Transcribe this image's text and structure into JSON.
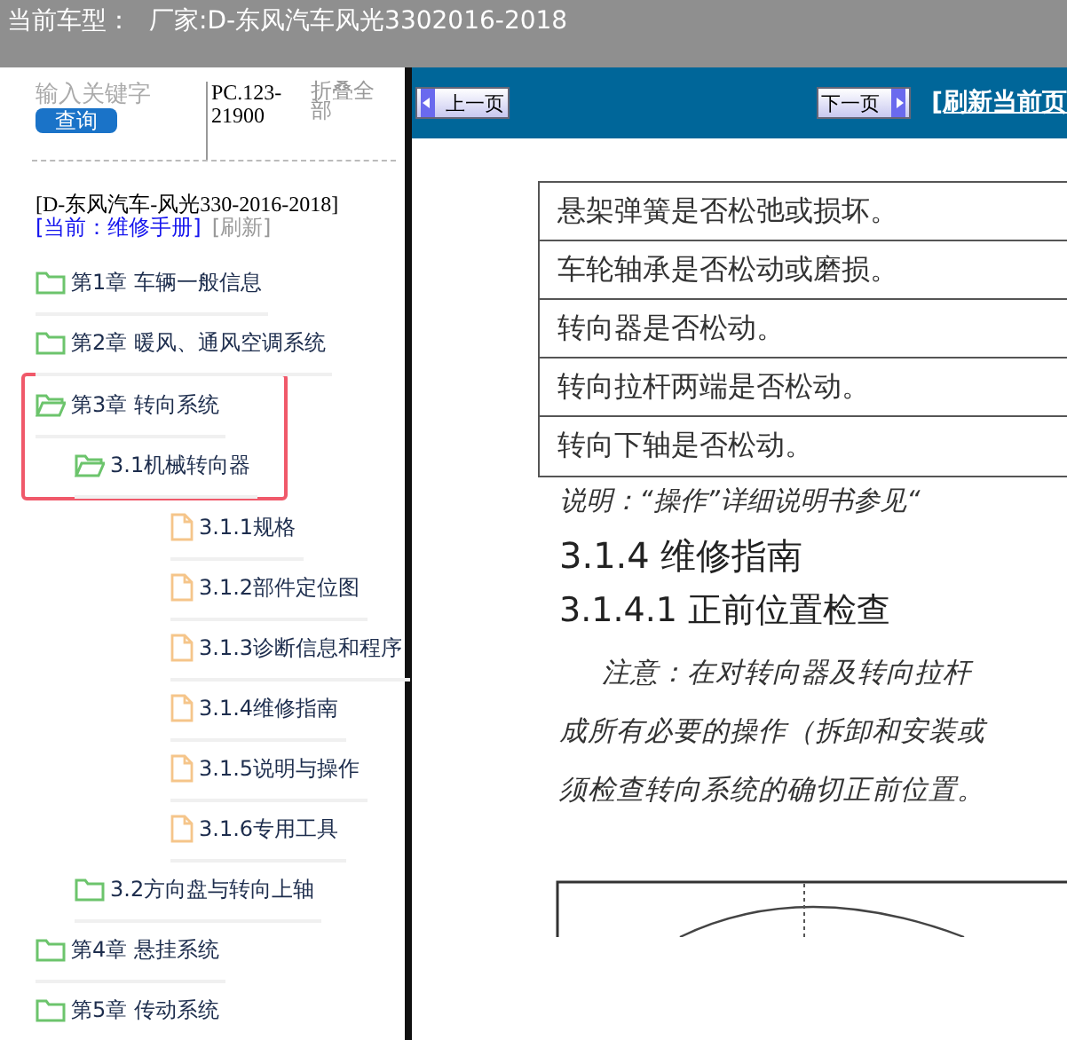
{
  "header": {
    "label": "当前车型：",
    "value": "厂家:D-东风汽车风光3302016-2018"
  },
  "sidebar": {
    "search": {
      "placeholder": "输入关键字"
    },
    "search_button": "查询",
    "code": "PC.123-21900",
    "collapse_all": "折叠全部",
    "model": "[D-东风汽车-风光330-2016-2018]",
    "current": "[当前：维修手册]",
    "refresh": "[刷新]",
    "tree": [
      {
        "label": "第1章 车辆一般信息",
        "kind": "folder",
        "expanded": false,
        "highlighted": false
      },
      {
        "label": "第2章 暖风、通风空调系统",
        "kind": "folder",
        "expanded": false,
        "highlighted": false
      },
      {
        "label": "第3章 转向系统",
        "kind": "folder",
        "expanded": true,
        "highlighted": true,
        "children": [
          {
            "label": "3.1机械转向器",
            "kind": "folder",
            "expanded": true,
            "highlighted": true,
            "children": [
              {
                "label": "3.1.1规格",
                "kind": "page",
                "highlighted": false
              },
              {
                "label": "3.1.2部件定位图",
                "kind": "page",
                "highlighted": false
              },
              {
                "label": "3.1.3诊断信息和程序",
                "kind": "page",
                "highlighted": false
              },
              {
                "label": "3.1.4维修指南",
                "kind": "page",
                "highlighted": false
              },
              {
                "label": "3.1.5说明与操作",
                "kind": "page",
                "highlighted": false
              },
              {
                "label": "3.1.6专用工具",
                "kind": "page",
                "highlighted": false
              }
            ]
          },
          {
            "label": "3.2方向盘与转向上轴",
            "kind": "folder",
            "expanded": false,
            "highlighted": false
          }
        ]
      },
      {
        "label": "第4章 悬挂系统",
        "kind": "folder",
        "expanded": false,
        "highlighted": false
      },
      {
        "label": "第5章 传动系统",
        "kind": "folder",
        "expanded": false,
        "highlighted": false
      }
    ]
  },
  "toolbar": {
    "prev": "上一页",
    "next": "下一页",
    "refresh_link": "[刷新当前页"
  },
  "document": {
    "table_rows": [
      "悬架弹簧是否松弛或损坏。",
      "车轮轴承是否松动或磨损。",
      "转向器是否松动。",
      "转向拉杆两端是否松动。",
      "转向下轴是否松动。"
    ],
    "note": "说明：“操作”详细说明书参见“",
    "heading": "3.1.4 维修指南",
    "subheading": "3.1.4.1 正前位置检查",
    "paragraph": [
      "注意：在对转向器及转向拉杆",
      "成所有必要的操作（拆卸和安装或",
      "须检查转向系统的确切正前位置。"
    ]
  }
}
